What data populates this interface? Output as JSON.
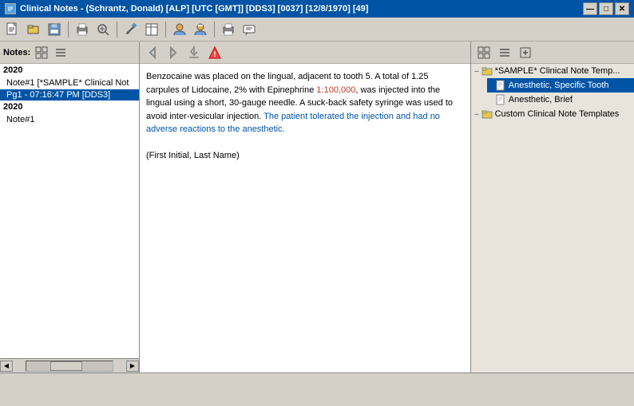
{
  "titleBar": {
    "title": "Clinical Notes - (Schrantz, Donald) [ALP] [UTC [GMT]] [DDS3] [0037] [12/8/1970] [49]",
    "icon": "📋",
    "minimize": "—",
    "maximize": "□",
    "close": "✕"
  },
  "menuBar": {
    "items": []
  },
  "leftPanel": {
    "header": "Notes:",
    "notes": [
      {
        "year": "2020",
        "items": [
          {
            "label": "Note#1 [*SAMPLE* Clinical Not",
            "subItems": [
              {
                "label": "Pg1 - 07:16:47 PM [DDS3]",
                "selected": true
              }
            ]
          }
        ]
      },
      {
        "year": "2020",
        "items": [
          {
            "label": "Note#1",
            "subItems": []
          }
        ]
      }
    ]
  },
  "noteContent": {
    "paragraph1": "Benzocaine was placed on the lingual, adjacent to tooth 5. A total of 1.25 carpules of Lidocaine, 2% with Epinephrine 1:100,000, was injected into the lingual using a short, 30-gauge needle. A suck-back safety syringe was used to avoid inter-vesicular injection. The patient tolerated the injection and had no adverse reactions to the anesthetic.",
    "paragraph2": "(First Initial, Last Name)"
  },
  "rightPanel": {
    "templates": {
      "sampleGroup": {
        "label": "*SAMPLE* Clinical Note Temp...",
        "children": [
          {
            "label": "Anesthetic, Specific Tooth",
            "selected": true
          },
          {
            "label": "Anesthetic, Brief"
          }
        ]
      },
      "customGroup": {
        "label": "Custom Clinical Note Templates"
      }
    }
  },
  "toolbar": {
    "buttons": [
      "📄",
      "💾",
      "🖨️",
      "✏️",
      "📋",
      "🔍",
      "🖊️",
      "📰",
      "👤",
      "🔒",
      "🖨️",
      "💬"
    ]
  },
  "icons": {
    "grid1": "⊞",
    "grid2": "⊟",
    "grid3": "⊠",
    "arrow_left": "◀",
    "arrow_right": "▶",
    "collapse": "—",
    "expand": "+"
  }
}
